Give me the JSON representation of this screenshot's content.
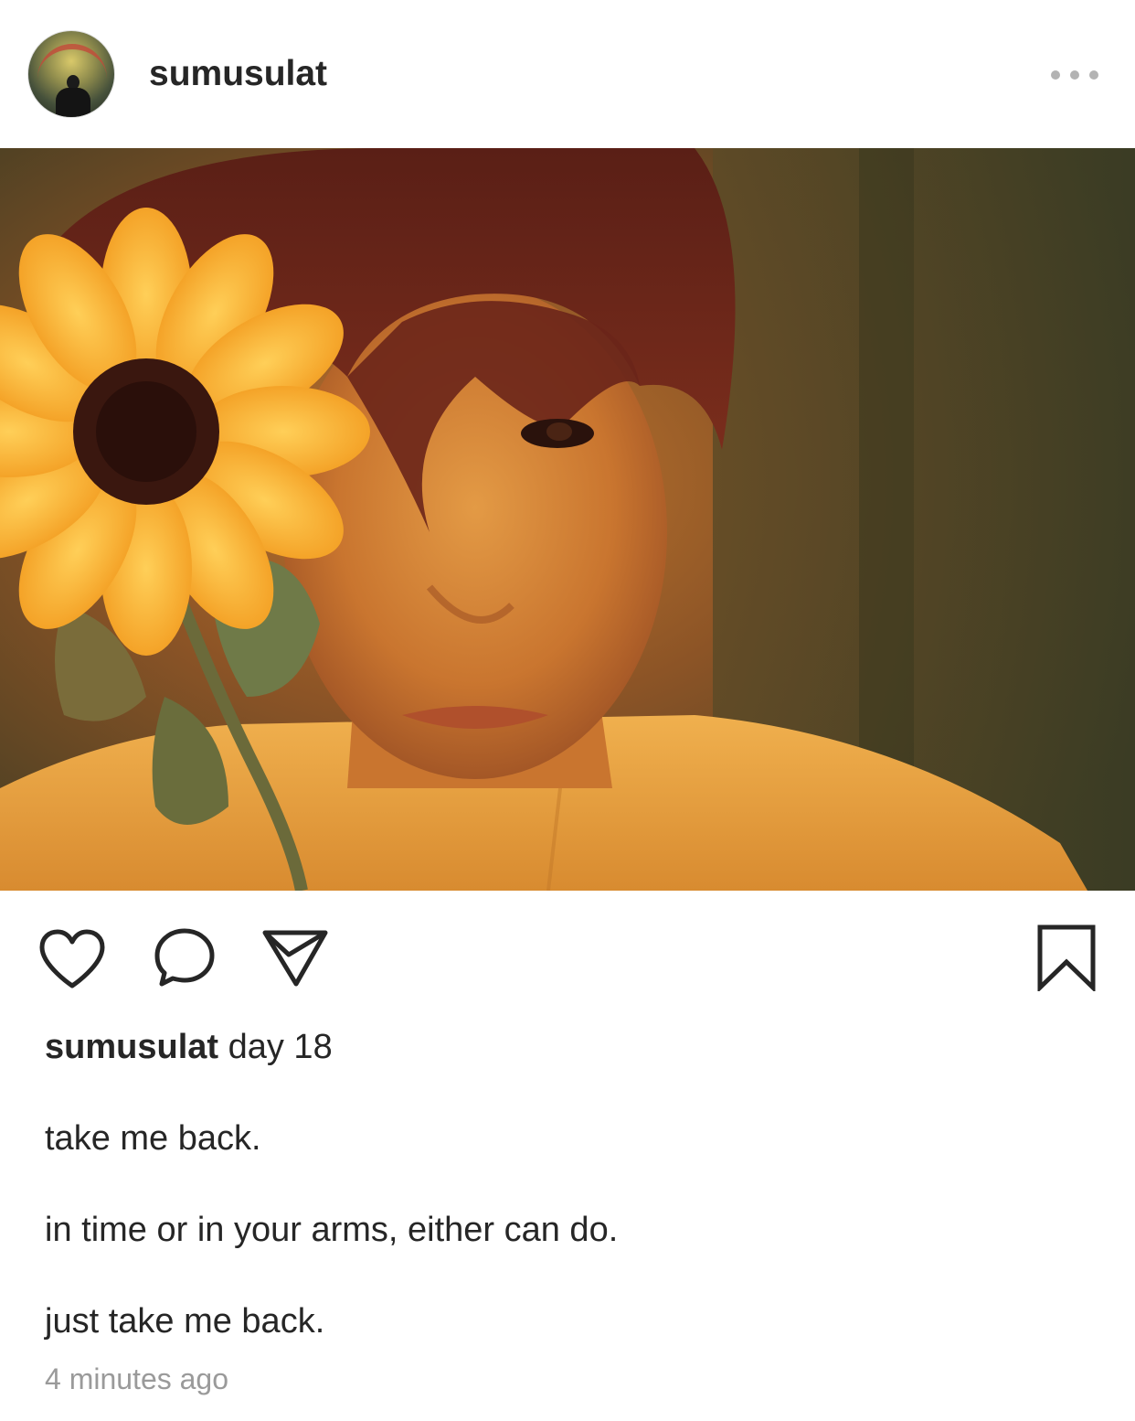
{
  "post": {
    "username": "sumusulat",
    "caption_username": "sumusulat",
    "caption_first": "day 18",
    "caption_lines": [
      "take me back.",
      "in time or in your arms, either can do.",
      "just take me back."
    ],
    "timestamp": "4 minutes ago"
  },
  "icons": {
    "more": "more-options-icon",
    "like": "heart-icon",
    "comment": "comment-icon",
    "share": "paper-plane-icon",
    "save": "bookmark-icon"
  },
  "colors": {
    "text": "#262626",
    "muted": "#9a9a9a",
    "dots": "#b3b3b3"
  }
}
